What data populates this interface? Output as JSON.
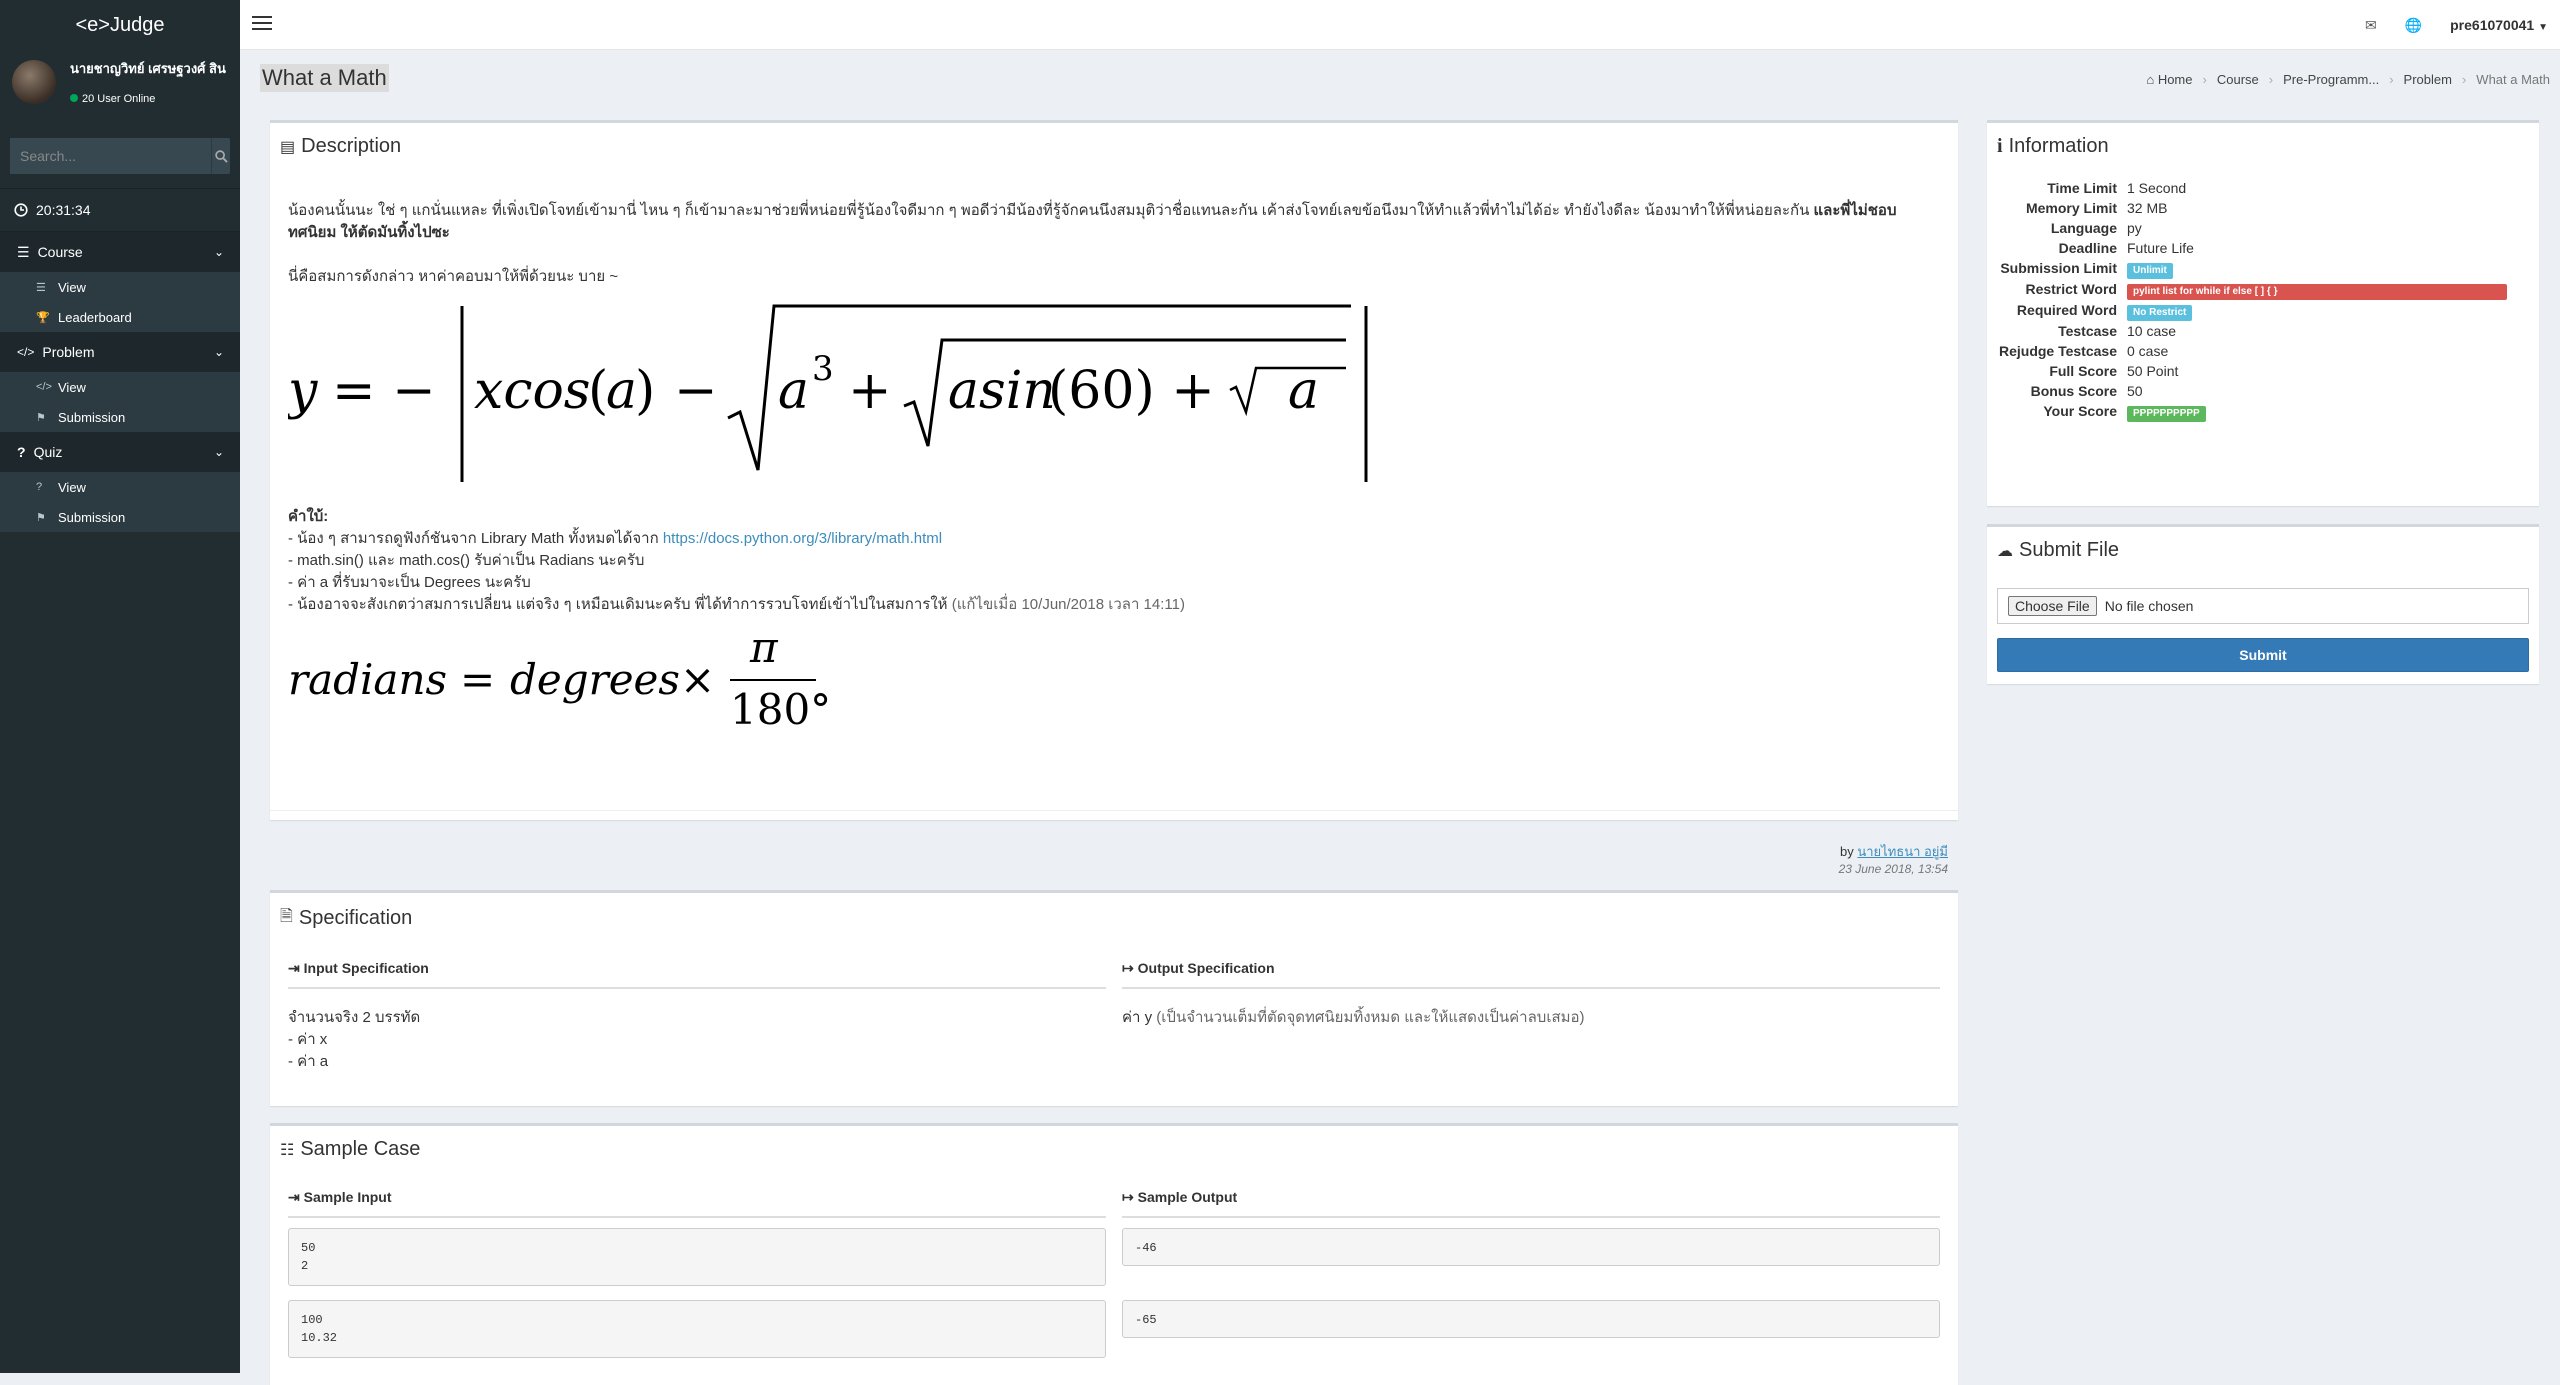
{
  "app": {
    "logo": "<e>Judge"
  },
  "user": {
    "name": "นายชาญวิทย์ เศรษฐวงศ์ สิน",
    "online": "20 User Online"
  },
  "search": {
    "placeholder": "Search..."
  },
  "clock": "20:31:34",
  "menu": {
    "course": {
      "label": "Course",
      "items": [
        "View",
        "Leaderboard"
      ]
    },
    "problem": {
      "label": "Problem",
      "items": [
        "View",
        "Submission"
      ]
    },
    "quiz": {
      "label": "Quiz",
      "items": [
        "View",
        "Submission"
      ]
    }
  },
  "topbar": {
    "username": "pre61070041"
  },
  "page": {
    "title": "What a Math"
  },
  "breadcrumb": [
    "Home",
    "Course",
    "Pre-Programm...",
    "Problem",
    "What a Math"
  ],
  "description": {
    "title": "Description",
    "intro": "น้องคนนั้นนะ ใช่ ๆ แกนั่นแหละ ที่เพิ่งเปิดโจทย์เข้ามานี่ ไหน ๆ ก็เข้ามาละมาช่วยพี่หน่อยพี่รู้น้องใจดีมาก ๆ พอดีว่ามีน้องที่รู้จักคนนึงสมมุติว่าชื่อแทนละกัน เค้าส่งโจทย์เลขข้อนึงมาให้ทำแล้วพี่ทำไม่ได้อ่ะ ทำยังไงดีละ น้องมาทำให้พี่หน่อยละกัน",
    "intro_bold": "และพี่ไม่ชอบทศนิยม ให้ตัดมันทิ้งไปซะ",
    "line2": "นี่คือสมการดังกล่าว หาค่าคอบมาให้พี่ด้วยนะ บาย ~",
    "hint_title": "คำใบ้:",
    "hint1_prefix": "- น้อง ๆ สามารถดูฟังก์ชันจาก Library Math ทั้งหมดได้จาก",
    "hint1_link": "https://docs.python.org/3/library/math.html",
    "hint2": "- math.sin() และ math.cos() รับค่าเป็น Radians นะครับ",
    "hint3": "- ค่า a ที่รับมาจะเป็น Degrees นะครับ",
    "hint4": "- น้องอาจจะสังเกตว่าสมการเปลี่ยน แต่จริง ๆ เหมือนเดิมนะครับ พี่ได้ทำการรวบโจทย์เข้าไปในสมการให้",
    "hint4_note": "(แก้ไขเมื่อ 10/Jun/2018 เวลา 14:11)",
    "by": "by",
    "author": "นายไทธนา อยู่มี",
    "date": "23 June 2018, 13:54"
  },
  "specification": {
    "title": "Specification",
    "input_head": "Input Specification",
    "output_head": "Output Specification",
    "input_lines": [
      "จำนวนจริง 2 บรรทัด",
      "- ค่า x",
      "- ค่า a"
    ],
    "output_prefix": "ค่า y",
    "output_note": "(เป็นจำนวนเต็มที่ตัดจุดทศนิยมทิ้งหมด และให้แสดงเป็นค่าลบเสมอ)"
  },
  "samples": {
    "title": "Sample Case",
    "input_head": "Sample Input",
    "output_head": "Sample Output",
    "cases": [
      {
        "input": "50\n2",
        "output": "-46"
      },
      {
        "input": "100\n10.32",
        "output": "-65"
      }
    ]
  },
  "information": {
    "title": "Information",
    "rows": [
      {
        "k": "Time Limit",
        "v": "1 Second"
      },
      {
        "k": "Memory Limit",
        "v": "32 MB"
      },
      {
        "k": "Language",
        "v": "py"
      },
      {
        "k": "Deadline",
        "v": "Future Life"
      },
      {
        "k": "Submission Limit",
        "badge": "Unlimit",
        "color": "#5bc0de"
      },
      {
        "k": "Restrict Word",
        "badge": "pylint list for while if else [ ] { }",
        "color": "#d9534f",
        "wide": true
      },
      {
        "k": "Required Word",
        "badge": "No Restrict",
        "color": "#5bc0de"
      },
      {
        "k": "Testcase",
        "v": "10 case"
      },
      {
        "k": "Rejudge Testcase",
        "v": "0 case"
      },
      {
        "k": "Full Score",
        "v": "50 Point"
      },
      {
        "k": "Bonus Score",
        "v": "50"
      },
      {
        "k": "Your Score",
        "badge": "PPPPPPPPPP",
        "color": "#5cb85c"
      }
    ]
  },
  "submit": {
    "title": "Submit File",
    "choose": "Choose File",
    "nofile": "No file chosen",
    "button": "Submit"
  }
}
